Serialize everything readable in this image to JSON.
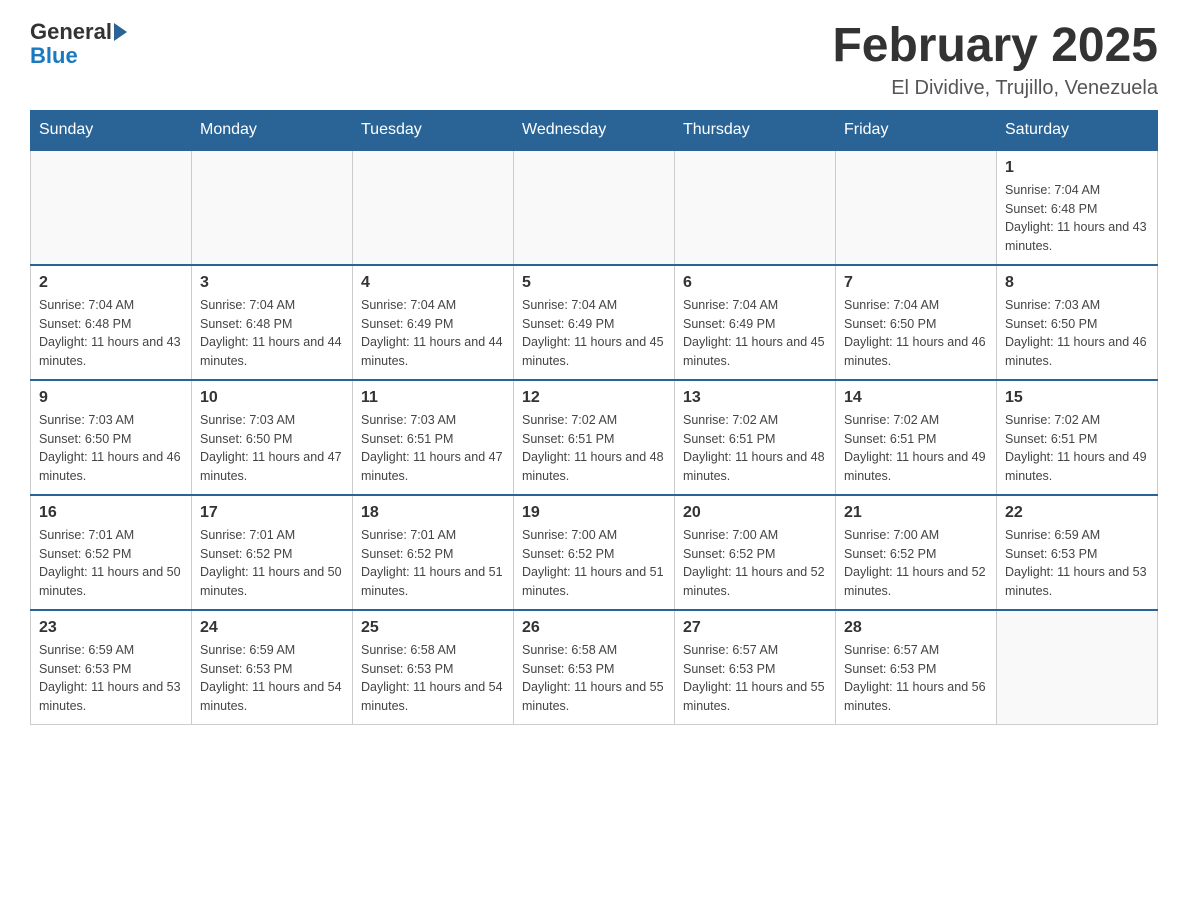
{
  "header": {
    "logo_text_general": "General",
    "logo_text_blue": "Blue",
    "title": "February 2025",
    "subtitle": "El Dividive, Trujillo, Venezuela"
  },
  "days_of_week": [
    "Sunday",
    "Monday",
    "Tuesday",
    "Wednesday",
    "Thursday",
    "Friday",
    "Saturday"
  ],
  "weeks": [
    [
      {
        "day": "",
        "info": ""
      },
      {
        "day": "",
        "info": ""
      },
      {
        "day": "",
        "info": ""
      },
      {
        "day": "",
        "info": ""
      },
      {
        "day": "",
        "info": ""
      },
      {
        "day": "",
        "info": ""
      },
      {
        "day": "1",
        "info": "Sunrise: 7:04 AM\nSunset: 6:48 PM\nDaylight: 11 hours and 43 minutes."
      }
    ],
    [
      {
        "day": "2",
        "info": "Sunrise: 7:04 AM\nSunset: 6:48 PM\nDaylight: 11 hours and 43 minutes."
      },
      {
        "day": "3",
        "info": "Sunrise: 7:04 AM\nSunset: 6:48 PM\nDaylight: 11 hours and 44 minutes."
      },
      {
        "day": "4",
        "info": "Sunrise: 7:04 AM\nSunset: 6:49 PM\nDaylight: 11 hours and 44 minutes."
      },
      {
        "day": "5",
        "info": "Sunrise: 7:04 AM\nSunset: 6:49 PM\nDaylight: 11 hours and 45 minutes."
      },
      {
        "day": "6",
        "info": "Sunrise: 7:04 AM\nSunset: 6:49 PM\nDaylight: 11 hours and 45 minutes."
      },
      {
        "day": "7",
        "info": "Sunrise: 7:04 AM\nSunset: 6:50 PM\nDaylight: 11 hours and 46 minutes."
      },
      {
        "day": "8",
        "info": "Sunrise: 7:03 AM\nSunset: 6:50 PM\nDaylight: 11 hours and 46 minutes."
      }
    ],
    [
      {
        "day": "9",
        "info": "Sunrise: 7:03 AM\nSunset: 6:50 PM\nDaylight: 11 hours and 46 minutes."
      },
      {
        "day": "10",
        "info": "Sunrise: 7:03 AM\nSunset: 6:50 PM\nDaylight: 11 hours and 47 minutes."
      },
      {
        "day": "11",
        "info": "Sunrise: 7:03 AM\nSunset: 6:51 PM\nDaylight: 11 hours and 47 minutes."
      },
      {
        "day": "12",
        "info": "Sunrise: 7:02 AM\nSunset: 6:51 PM\nDaylight: 11 hours and 48 minutes."
      },
      {
        "day": "13",
        "info": "Sunrise: 7:02 AM\nSunset: 6:51 PM\nDaylight: 11 hours and 48 minutes."
      },
      {
        "day": "14",
        "info": "Sunrise: 7:02 AM\nSunset: 6:51 PM\nDaylight: 11 hours and 49 minutes."
      },
      {
        "day": "15",
        "info": "Sunrise: 7:02 AM\nSunset: 6:51 PM\nDaylight: 11 hours and 49 minutes."
      }
    ],
    [
      {
        "day": "16",
        "info": "Sunrise: 7:01 AM\nSunset: 6:52 PM\nDaylight: 11 hours and 50 minutes."
      },
      {
        "day": "17",
        "info": "Sunrise: 7:01 AM\nSunset: 6:52 PM\nDaylight: 11 hours and 50 minutes."
      },
      {
        "day": "18",
        "info": "Sunrise: 7:01 AM\nSunset: 6:52 PM\nDaylight: 11 hours and 51 minutes."
      },
      {
        "day": "19",
        "info": "Sunrise: 7:00 AM\nSunset: 6:52 PM\nDaylight: 11 hours and 51 minutes."
      },
      {
        "day": "20",
        "info": "Sunrise: 7:00 AM\nSunset: 6:52 PM\nDaylight: 11 hours and 52 minutes."
      },
      {
        "day": "21",
        "info": "Sunrise: 7:00 AM\nSunset: 6:52 PM\nDaylight: 11 hours and 52 minutes."
      },
      {
        "day": "22",
        "info": "Sunrise: 6:59 AM\nSunset: 6:53 PM\nDaylight: 11 hours and 53 minutes."
      }
    ],
    [
      {
        "day": "23",
        "info": "Sunrise: 6:59 AM\nSunset: 6:53 PM\nDaylight: 11 hours and 53 minutes."
      },
      {
        "day": "24",
        "info": "Sunrise: 6:59 AM\nSunset: 6:53 PM\nDaylight: 11 hours and 54 minutes."
      },
      {
        "day": "25",
        "info": "Sunrise: 6:58 AM\nSunset: 6:53 PM\nDaylight: 11 hours and 54 minutes."
      },
      {
        "day": "26",
        "info": "Sunrise: 6:58 AM\nSunset: 6:53 PM\nDaylight: 11 hours and 55 minutes."
      },
      {
        "day": "27",
        "info": "Sunrise: 6:57 AM\nSunset: 6:53 PM\nDaylight: 11 hours and 55 minutes."
      },
      {
        "day": "28",
        "info": "Sunrise: 6:57 AM\nSunset: 6:53 PM\nDaylight: 11 hours and 56 minutes."
      },
      {
        "day": "",
        "info": ""
      }
    ]
  ]
}
